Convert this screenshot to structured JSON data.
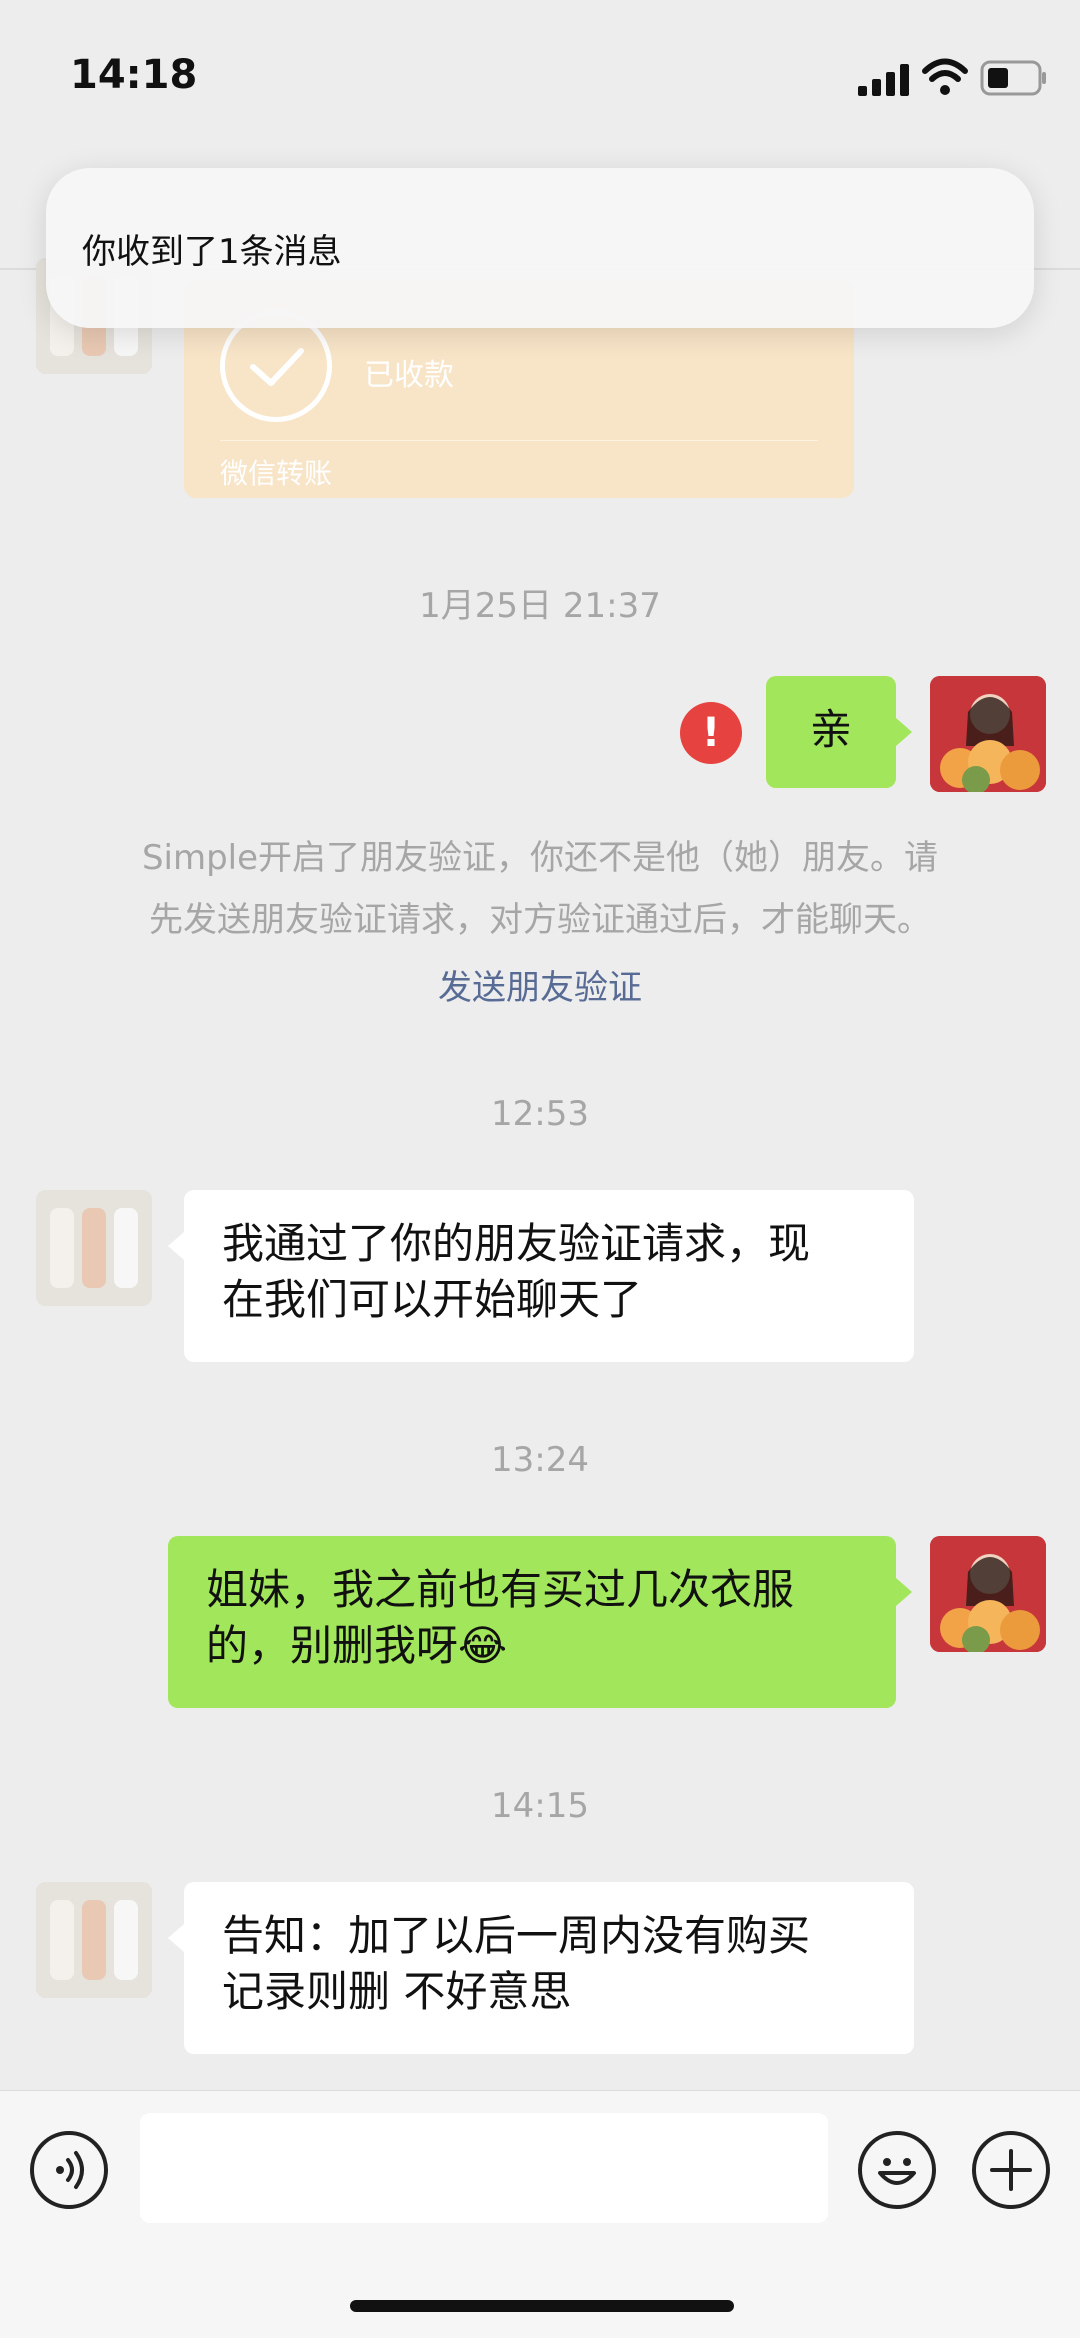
{
  "status_bar": {
    "time": "14:18"
  },
  "notification": {
    "text": "你收到了1条消息"
  },
  "transfer_card": {
    "status": "已收款",
    "label": "微信转账"
  },
  "messages": {
    "ts1": "1月25日 21:37",
    "out1": "亲",
    "system_notice_line1": "Simple开启了朋友验证，你还不是他（她）朋友。请",
    "system_notice_line2": "先发送朋友验证请求，对方验证通过后，才能聊天。",
    "verify_link": "发送朋友验证",
    "ts2": "12:53",
    "in1_line1": "我通过了你的朋友验证请求，现",
    "in1_line2": "在我们可以开始聊天了",
    "ts3": "13:24",
    "out2_line1": "姐妹，我之前也有买过几次衣服",
    "out2_line2": "的，别删我呀😂",
    "ts4": "14:15",
    "in2_line1": "告知：加了以后一周内没有购买",
    "in2_line2": "记录则删 不好意思"
  },
  "colors": {
    "bubble_green": "#a2e65b",
    "error_red": "#e64340",
    "link_blue": "#576b95",
    "background": "#ededed"
  }
}
